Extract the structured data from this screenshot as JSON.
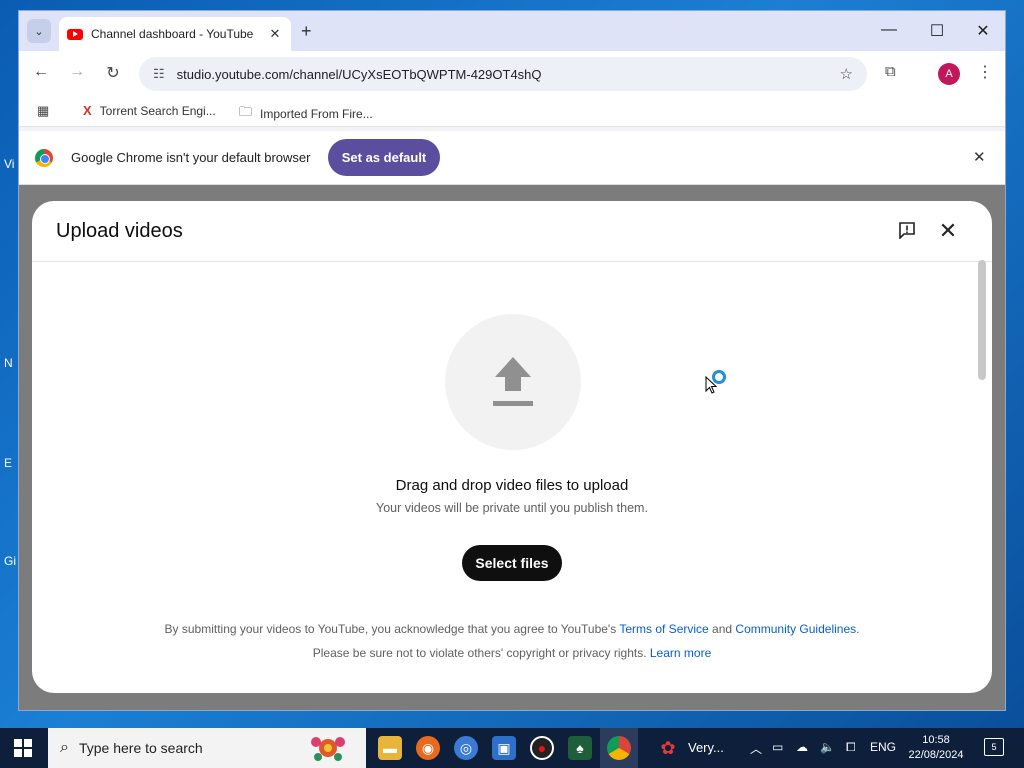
{
  "browser": {
    "tab_title": "Channel dashboard - YouTube",
    "url": "studio.youtube.com/channel/UCyXsEOTbQWPTM-429OT4shQ",
    "profile_initial": "A",
    "bookmarks": [
      {
        "label": "Torrent Search Engi...",
        "icon": "torrent-x-icon"
      },
      {
        "label": "Imported From Fire...",
        "icon": "folder-icon"
      }
    ],
    "infobar": {
      "message": "Google Chrome isn't your default browser",
      "button_label": "Set as default"
    }
  },
  "dialog": {
    "title": "Upload videos",
    "drag_text": "Drag and drop video files to upload",
    "private_note": "Your videos will be private until you publish them.",
    "select_button": "Select files",
    "legal_line1_prefix": "By submitting your videos to YouTube, you acknowledge that you agree to YouTube's ",
    "terms_link": "Terms of Service",
    "and_text": " and ",
    "guidelines_link": "Community Guidelines",
    "period": ".",
    "legal_line2_prefix": "Please be sure not to violate others' copyright or privacy rights. ",
    "learn_more_link": "Learn more"
  },
  "taskbar": {
    "search_placeholder": "Type here to search",
    "app_label": "Very...",
    "language": "ENG",
    "time": "10:58",
    "date": "22/08/2024",
    "notification_count": "5"
  },
  "desktop": {
    "icon_label_fragments": [
      "Vi",
      "N",
      "E",
      "Gi"
    ]
  },
  "colors": {
    "accent_button": "#5c4e9f",
    "youtube_red": "#ff0000",
    "link_blue": "#065fd4",
    "select_button": "#0f0f0f"
  }
}
